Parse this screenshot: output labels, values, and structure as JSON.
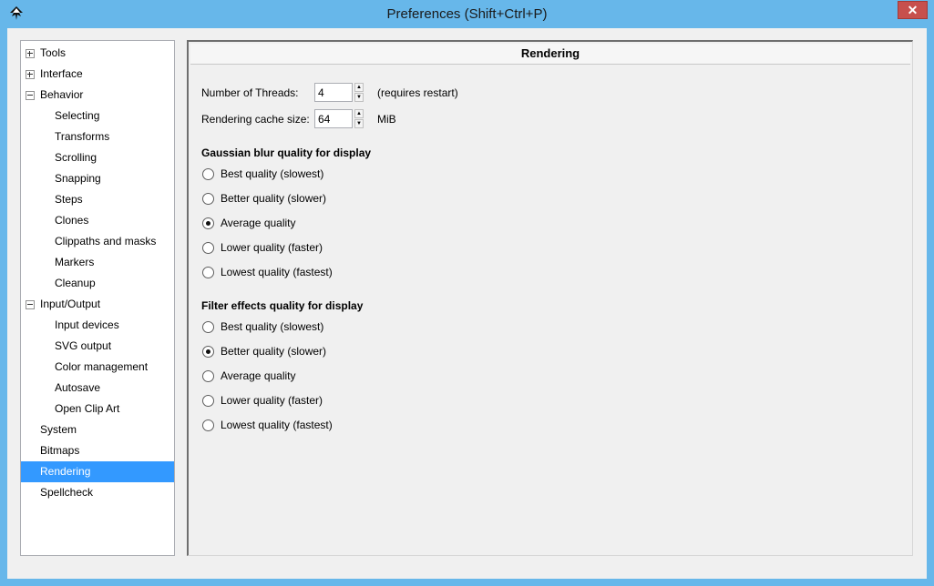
{
  "window": {
    "title": "Preferences (Shift+Ctrl+P)",
    "close_glyph": "✕"
  },
  "tree": {
    "items": [
      {
        "label": "Tools",
        "expander": "plus"
      },
      {
        "label": "Interface",
        "expander": "plus"
      },
      {
        "label": "Behavior",
        "expander": "minus"
      },
      {
        "label": "Selecting"
      },
      {
        "label": "Transforms"
      },
      {
        "label": "Scrolling"
      },
      {
        "label": "Snapping"
      },
      {
        "label": "Steps"
      },
      {
        "label": "Clones"
      },
      {
        "label": "Clippaths and masks"
      },
      {
        "label": "Markers"
      },
      {
        "label": "Cleanup"
      },
      {
        "label": "Input/Output",
        "expander": "minus"
      },
      {
        "label": "Input devices"
      },
      {
        "label": "SVG output"
      },
      {
        "label": "Color management"
      },
      {
        "label": "Autosave"
      },
      {
        "label": "Open Clip Art"
      },
      {
        "label": "System"
      },
      {
        "label": "Bitmaps"
      },
      {
        "label": "Rendering",
        "selected": true
      },
      {
        "label": "Spellcheck"
      }
    ]
  },
  "panel": {
    "header": "Rendering",
    "threads": {
      "label": "Number of Threads:",
      "value": "4",
      "note": "(requires restart)"
    },
    "cache": {
      "label": "Rendering cache size:",
      "value": "64",
      "unit": "MiB"
    },
    "gaussian": {
      "title": "Gaussian blur quality for display",
      "options": [
        {
          "label": "Best quality (slowest)",
          "checked": false
        },
        {
          "label": "Better quality (slower)",
          "checked": false
        },
        {
          "label": "Average quality",
          "checked": true
        },
        {
          "label": "Lower quality (faster)",
          "checked": false
        },
        {
          "label": "Lowest quality (fastest)",
          "checked": false
        }
      ]
    },
    "filter": {
      "title": "Filter effects quality for display",
      "options": [
        {
          "label": "Best quality (slowest)",
          "checked": false
        },
        {
          "label": "Better quality (slower)",
          "checked": true
        },
        {
          "label": "Average quality",
          "checked": false
        },
        {
          "label": "Lower quality (faster)",
          "checked": false
        },
        {
          "label": "Lowest quality (fastest)",
          "checked": false
        }
      ]
    }
  },
  "colors": {
    "title_bar": "#67b7ea",
    "selection": "#3399ff",
    "close_button": "#c7504d"
  },
  "icons": {
    "app": "inkscape-icon",
    "spin_up": "▲",
    "spin_down": "▼"
  }
}
